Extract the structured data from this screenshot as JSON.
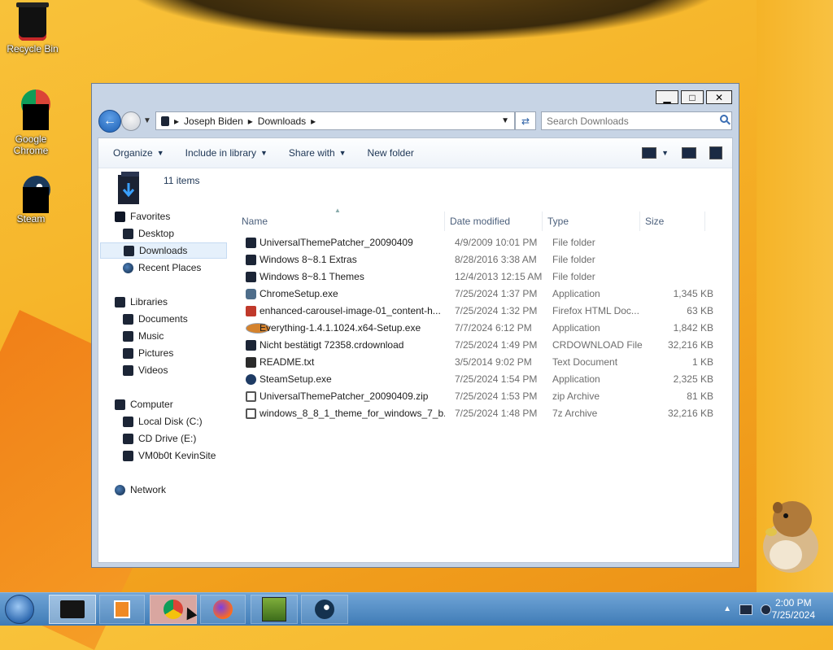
{
  "desktop": {
    "icons": [
      {
        "label": "Recycle Bin"
      },
      {
        "label": "Google Chrome"
      },
      {
        "label": "Steam"
      }
    ]
  },
  "window": {
    "controls": {
      "minimize": "▁",
      "maximize": "□",
      "close": "✕"
    },
    "address": {
      "crumbs": [
        "Joseph Biden",
        "Downloads"
      ]
    },
    "search": {
      "placeholder": "Search Downloads"
    },
    "toolbar": {
      "organize": "Organize",
      "include": "Include in library",
      "share": "Share with",
      "new_folder": "New folder"
    },
    "items_count": "11 items",
    "nav": {
      "favorites": "Favorites",
      "desktop": "Desktop",
      "downloads": "Downloads",
      "recent": "Recent Places",
      "libraries": "Libraries",
      "documents": "Documents",
      "music": "Music",
      "pictures": "Pictures",
      "videos": "Videos",
      "computer": "Computer",
      "local_disk": "Local Disk (C:)",
      "cd_drive": "CD Drive (E:)",
      "vmsite": "VM0b0t KevinSite",
      "network": "Network"
    },
    "columns": {
      "name": "Name",
      "date": "Date modified",
      "type": "Type",
      "size": "Size"
    },
    "files": [
      {
        "name": "UniversalThemePatcher_20090409",
        "date": "4/9/2009 10:01 PM",
        "type": "File folder",
        "size": "",
        "icon": "folder-icon"
      },
      {
        "name": "Windows 8~8.1 Extras",
        "date": "8/28/2016 3:38 AM",
        "type": "File folder",
        "size": "",
        "icon": "folder-icon"
      },
      {
        "name": "Windows 8~8.1 Themes",
        "date": "12/4/2013 12:15 AM",
        "type": "File folder",
        "size": "",
        "icon": "folder-icon"
      },
      {
        "name": "ChromeSetup.exe",
        "date": "7/25/2024 1:37 PM",
        "type": "Application",
        "size": "1,345 KB",
        "icon": "app-icon"
      },
      {
        "name": "enhanced-carousel-image-01_content-h...",
        "date": "7/25/2024 1:32 PM",
        "type": "Firefox HTML Doc...",
        "size": "63 KB",
        "icon": "html-icon"
      },
      {
        "name": "Everything-1.4.1.1024.x64-Setup.exe",
        "date": "7/7/2024 6:12 PM",
        "type": "Application",
        "size": "1,842 KB",
        "icon": "search-app-icon"
      },
      {
        "name": "Nicht bestätigt 72358.crdownload",
        "date": "7/25/2024 1:49 PM",
        "type": "CRDOWNLOAD File",
        "size": "32,216 KB",
        "icon": "file-icon"
      },
      {
        "name": "README.txt",
        "date": "3/5/2014 9:02 PM",
        "type": "Text Document",
        "size": "1 KB",
        "icon": "text-file-icon"
      },
      {
        "name": "SteamSetup.exe",
        "date": "7/25/2024 1:54 PM",
        "type": "Application",
        "size": "2,325 KB",
        "icon": "steam-icon"
      },
      {
        "name": "UniversalThemePatcher_20090409.zip",
        "date": "7/25/2024 1:53 PM",
        "type": "zip Archive",
        "size": "81 KB",
        "icon": "zip-icon"
      },
      {
        "name": "windows_8_8_1_theme_for_windows_7_b...",
        "date": "7/25/2024 1:48 PM",
        "type": "7z Archive",
        "size": "32,216 KB",
        "icon": "zip-icon"
      }
    ]
  },
  "taskbar": {
    "clock_time": "2:00 PM",
    "clock_date": "7/25/2024",
    "buttons": [
      "explorer-icon",
      "media-player-icon",
      "chrome-icon",
      "firefox-icon",
      "box-game-icon",
      "steam-icon"
    ]
  }
}
